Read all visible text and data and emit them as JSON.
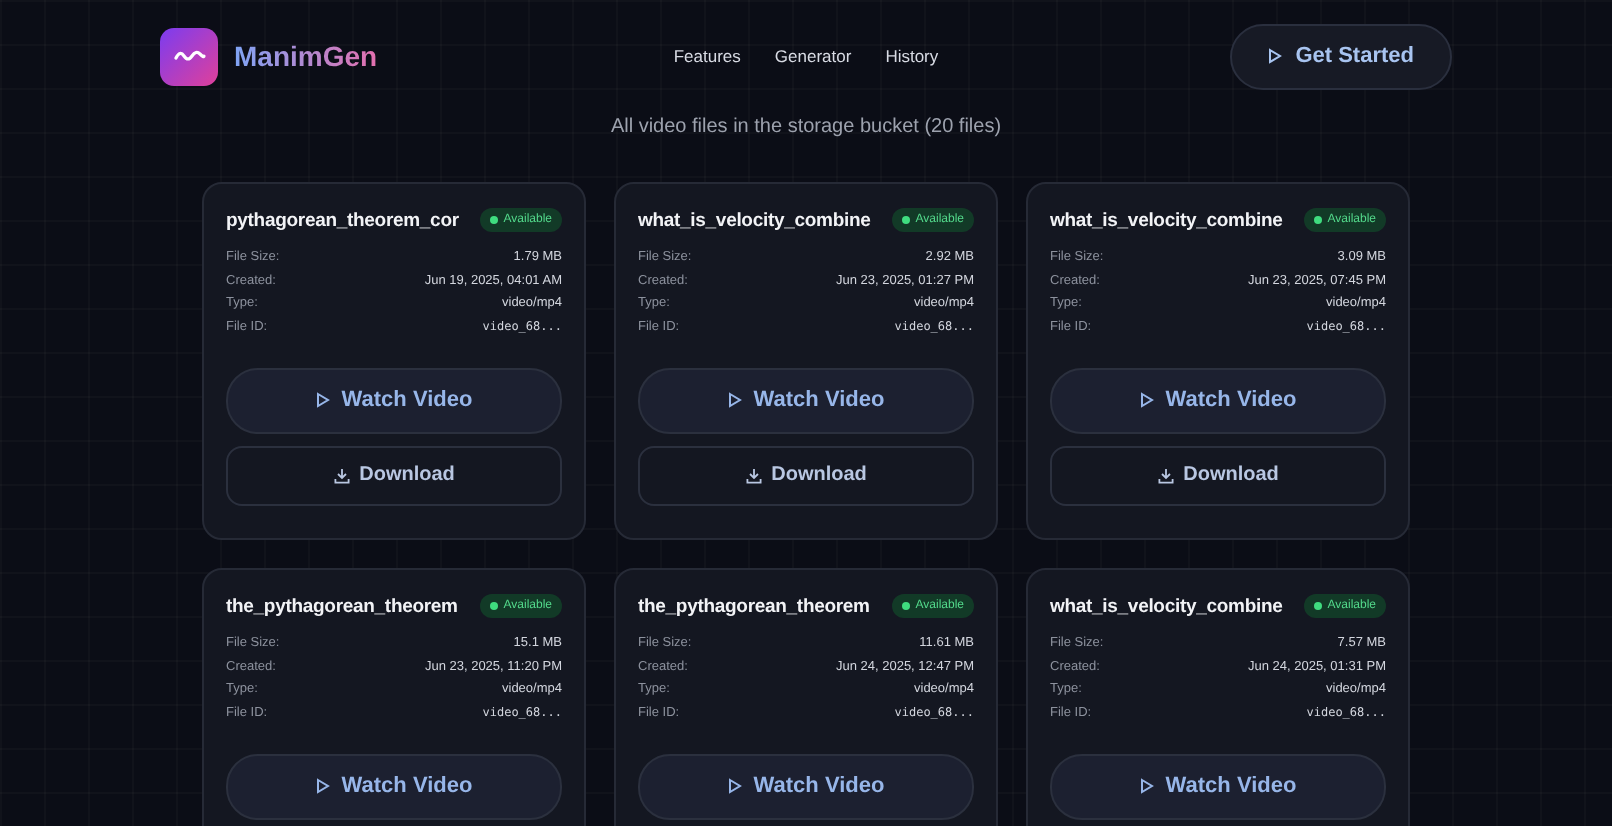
{
  "brand": {
    "name": "ManimGen"
  },
  "nav": [
    {
      "label": "Features"
    },
    {
      "label": "Generator"
    },
    {
      "label": "History"
    }
  ],
  "cta": {
    "label": "Get Started"
  },
  "subtitle": "All video files in the storage bucket (20 files)",
  "cards": [
    {
      "title": "pythagorean_theorem_cor",
      "status": "Available",
      "fields": [
        {
          "label": "File Size:",
          "value": "1.79 MB",
          "kind": "text"
        },
        {
          "label": "Created:",
          "value": "Jun 19, 2025, 04:01 AM",
          "kind": "text"
        },
        {
          "label": "Type:",
          "value": "video/mp4",
          "kind": "text"
        },
        {
          "label": "File ID:",
          "value": "video_68...",
          "kind": "mono"
        }
      ],
      "watch": "Watch Video",
      "download": "Download"
    },
    {
      "title": "what_is_velocity_combine",
      "status": "Available",
      "fields": [
        {
          "label": "File Size:",
          "value": "2.92 MB",
          "kind": "text"
        },
        {
          "label": "Created:",
          "value": "Jun 23, 2025, 01:27 PM",
          "kind": "text"
        },
        {
          "label": "Type:",
          "value": "video/mp4",
          "kind": "text"
        },
        {
          "label": "File ID:",
          "value": "video_68...",
          "kind": "mono"
        }
      ],
      "watch": "Watch Video",
      "download": "Download"
    },
    {
      "title": "what_is_velocity_combine",
      "status": "Available",
      "fields": [
        {
          "label": "File Size:",
          "value": "3.09 MB",
          "kind": "text"
        },
        {
          "label": "Created:",
          "value": "Jun 23, 2025, 07:45 PM",
          "kind": "text"
        },
        {
          "label": "Type:",
          "value": "video/mp4",
          "kind": "text"
        },
        {
          "label": "File ID:",
          "value": "video_68...",
          "kind": "mono"
        }
      ],
      "watch": "Watch Video",
      "download": "Download"
    },
    {
      "title": "the_pythagorean_theorem",
      "status": "Available",
      "fields": [
        {
          "label": "File Size:",
          "value": "15.1 MB",
          "kind": "text"
        },
        {
          "label": "Created:",
          "value": "Jun 23, 2025, 11:20 PM",
          "kind": "text"
        },
        {
          "label": "Type:",
          "value": "video/mp4",
          "kind": "text"
        },
        {
          "label": "File ID:",
          "value": "video_68...",
          "kind": "mono"
        }
      ],
      "watch": "Watch Video"
    },
    {
      "title": "the_pythagorean_theorem",
      "status": "Available",
      "fields": [
        {
          "label": "File Size:",
          "value": "11.61 MB",
          "kind": "text"
        },
        {
          "label": "Created:",
          "value": "Jun 24, 2025, 12:47 PM",
          "kind": "text"
        },
        {
          "label": "Type:",
          "value": "video/mp4",
          "kind": "text"
        },
        {
          "label": "File ID:",
          "value": "video_68...",
          "kind": "mono"
        }
      ],
      "watch": "Watch Video"
    },
    {
      "title": "what_is_velocity_combine",
      "status": "Available",
      "fields": [
        {
          "label": "File Size:",
          "value": "7.57 MB",
          "kind": "text"
        },
        {
          "label": "Created:",
          "value": "Jun 24, 2025, 01:31 PM",
          "kind": "text"
        },
        {
          "label": "Type:",
          "value": "video/mp4",
          "kind": "text"
        },
        {
          "label": "File ID:",
          "value": "video_68...",
          "kind": "mono"
        }
      ],
      "watch": "Watch Video"
    }
  ]
}
